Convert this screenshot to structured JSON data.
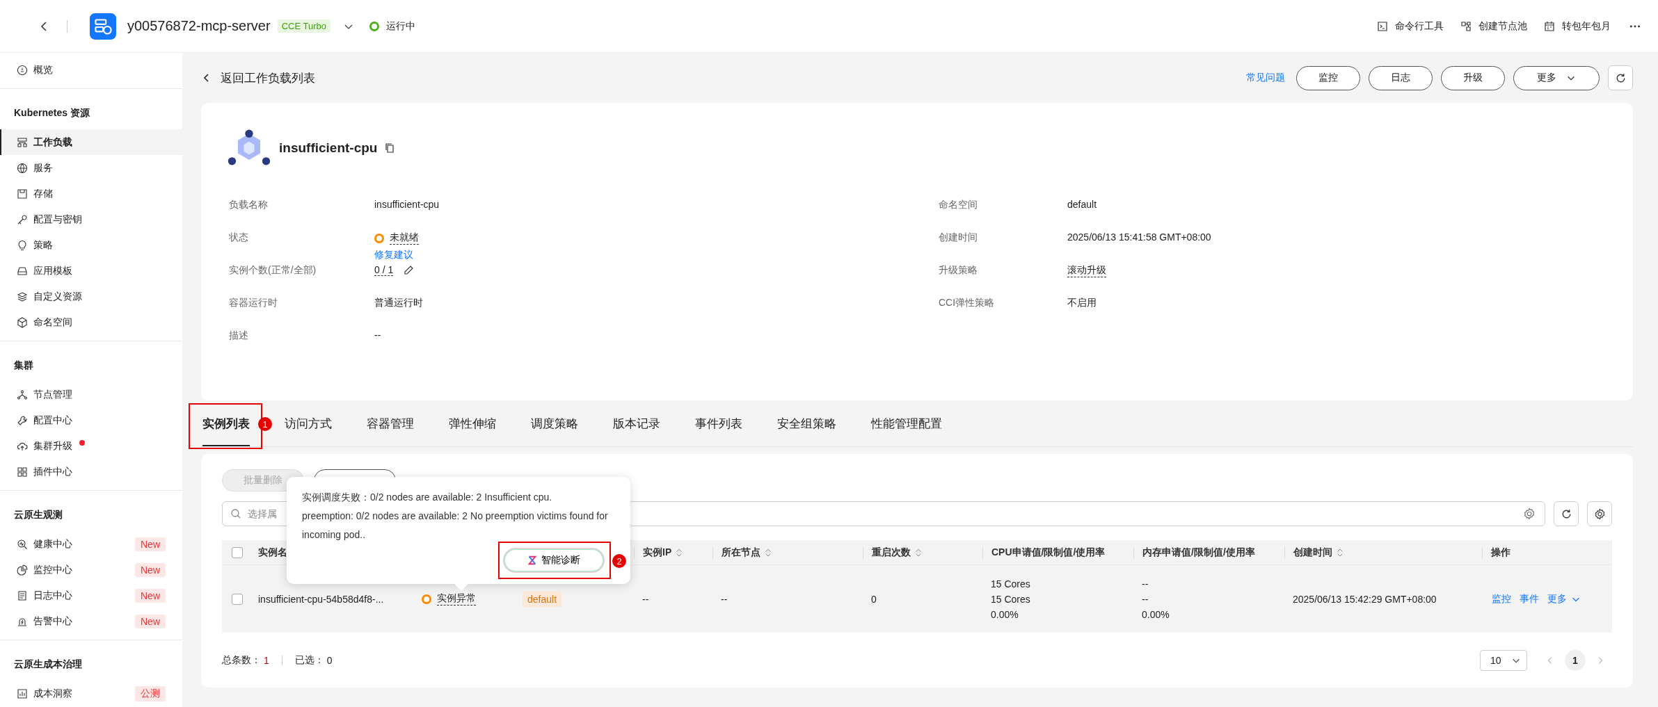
{
  "topbar": {
    "cluster_name": "y00576872-mcp-server",
    "cluster_tag": "CCE Turbo",
    "status": "运行中",
    "tools": [
      "命令行工具",
      "创建节点池",
      "转包年包月"
    ]
  },
  "sidebar": {
    "top_items": [
      {
        "label": "概览",
        "selected": false,
        "alert": false
      }
    ],
    "groups": [
      {
        "title": "Kubernetes 资源",
        "items": [
          {
            "label": "工作负载",
            "selected": true,
            "alert": false
          },
          {
            "label": "服务",
            "selected": false,
            "alert": false
          },
          {
            "label": "存储",
            "selected": false,
            "alert": false
          },
          {
            "label": "配置与密钥",
            "selected": false,
            "alert": false
          },
          {
            "label": "策略",
            "selected": false,
            "alert": false
          },
          {
            "label": "应用模板",
            "selected": false,
            "alert": false
          },
          {
            "label": "自定义资源",
            "selected": false,
            "alert": false
          },
          {
            "label": "命名空间",
            "selected": false,
            "alert": false
          }
        ]
      },
      {
        "title": "集群",
        "items": [
          {
            "label": "节点管理",
            "selected": false,
            "alert": false
          },
          {
            "label": "配置中心",
            "selected": false,
            "alert": false
          },
          {
            "label": "集群升级",
            "selected": false,
            "alert": true
          },
          {
            "label": "插件中心",
            "selected": false,
            "alert": false
          }
        ]
      },
      {
        "title": "云原生观测",
        "items": [
          {
            "label": "健康中心",
            "selected": false,
            "alert": false,
            "badge": "New"
          },
          {
            "label": "监控中心",
            "selected": false,
            "alert": false,
            "badge": "New"
          },
          {
            "label": "日志中心",
            "selected": false,
            "alert": false,
            "badge": "New"
          },
          {
            "label": "告警中心",
            "selected": false,
            "alert": false,
            "badge": "New"
          }
        ]
      },
      {
        "title": "云原生成本治理",
        "items": [
          {
            "label": "成本洞察",
            "selected": false,
            "alert": false,
            "badge": "公测"
          }
        ]
      }
    ]
  },
  "page": {
    "back_label": "返回工作负载列表",
    "faq_link": "常见问题",
    "actions": [
      {
        "label": "监控",
        "menu": false
      },
      {
        "label": "日志",
        "menu": false
      },
      {
        "label": "升级",
        "menu": false
      },
      {
        "label": "更多",
        "menu": true
      }
    ]
  },
  "workload": {
    "name": "insufficient-cpu",
    "fields_left": [
      {
        "label": "负载名称",
        "value": "insufficient-cpu",
        "kind": "text"
      },
      {
        "label": "状态",
        "value": "未就绪",
        "kind": "status",
        "link": "修复建议"
      },
      {
        "label": "实例个数(正常/全部)",
        "value": "0 / 1",
        "kind": "editable"
      },
      {
        "label": "容器运行时",
        "value": "普通运行时",
        "kind": "text"
      },
      {
        "label": "描述",
        "value": "--",
        "kind": "text"
      }
    ],
    "fields_right": [
      {
        "label": "命名空间",
        "value": "default",
        "kind": "text"
      },
      {
        "label": "创建时间",
        "value": "2025/06/13 15:41:58 GMT+08:00",
        "kind": "text"
      },
      {
        "label": "升级策略",
        "value": "滚动升级",
        "kind": "dashed"
      },
      {
        "label": "CCI弹性策略",
        "value": "不启用",
        "kind": "text"
      }
    ]
  },
  "tabs": [
    {
      "label": "实例列表",
      "selected": true,
      "annotation": "1"
    },
    {
      "label": "访问方式",
      "selected": false
    },
    {
      "label": "容器管理",
      "selected": false
    },
    {
      "label": "弹性伸缩",
      "selected": false
    },
    {
      "label": "调度策略",
      "selected": false
    },
    {
      "label": "版本记录",
      "selected": false
    },
    {
      "label": "事件列表",
      "selected": false
    },
    {
      "label": "安全组策略",
      "selected": false
    },
    {
      "label": "性能管理配置",
      "selected": false
    }
  ],
  "instances": {
    "batch_delete": {
      "label": "批量删除",
      "disabled": true
    },
    "search": {
      "placeholder": "选择属"
    },
    "header_checked": false,
    "columns": [
      {
        "label": "实例名"
      },
      {
        "label": "实例IP",
        "sortable": true
      },
      {
        "label": "所在节点",
        "sortable": true
      },
      {
        "label": "重启次数",
        "sortable": true
      },
      {
        "label": "CPU申请值/限制值/使用率",
        "sortable": false
      },
      {
        "label": "内存申请值/限制值/使用率",
        "sortable": false
      },
      {
        "label": "创建时间",
        "sortable": true
      },
      {
        "label": "操作",
        "sortable": false
      }
    ],
    "rows": [
      {
        "checked": false,
        "name": "insufficient-cpu-54b58d4f8-...",
        "status": "实例异常",
        "namespace": "default",
        "ip": "--",
        "node": "--",
        "restarts": "0",
        "cpu": [
          "15 Cores",
          "15 Cores",
          "0.00%"
        ],
        "memory": [
          "--",
          "--",
          "0.00%"
        ],
        "created": "2025/06/13 15:42:29 GMT+08:00",
        "actions": [
          "监控",
          "事件",
          "更多"
        ]
      }
    ],
    "total_label": "总条数：",
    "total": "1",
    "selected_label": "已选：",
    "selected_count": "0",
    "page_size": "10",
    "pages": [
      {
        "label": "1",
        "selected": true
      }
    ]
  },
  "popover": {
    "message": "实例调度失败：0/2 nodes are available: 2 Insufficient cpu.\npreemption: 0/2 nodes are available: 2 No preemption victims found for incoming pod..",
    "button": {
      "label": "智能诊断",
      "annotation": "2"
    }
  }
}
